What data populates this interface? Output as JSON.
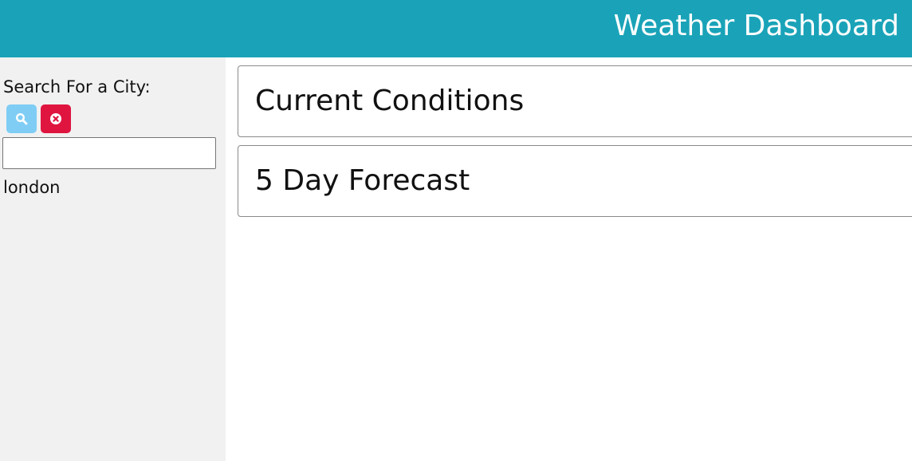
{
  "header": {
    "title": "Weather Dashboard",
    "background_color": "#1aa3b8"
  },
  "sidebar": {
    "search_label": "Search For a City:",
    "search_button": {
      "icon": "search-icon",
      "color": "#7fcdf5"
    },
    "clear_button": {
      "icon": "close-circle-icon",
      "color": "#df1540"
    },
    "city_input": {
      "value": "",
      "placeholder": ""
    },
    "history": [
      {
        "label": "london"
      }
    ]
  },
  "main": {
    "current_conditions_title": "Current Conditions",
    "forecast_title": "5 Day Forecast"
  }
}
